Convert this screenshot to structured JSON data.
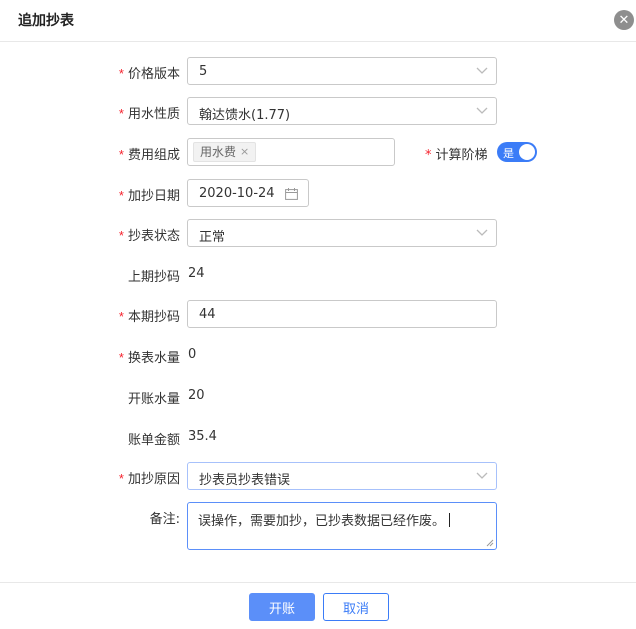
{
  "dialog": {
    "title": "追加抄表",
    "close_glyph": "✕"
  },
  "form": {
    "price_version": {
      "label": "价格版本",
      "value": "5"
    },
    "water_type": {
      "label": "用水性质",
      "value": "翰达馈水(1.77)"
    },
    "fee_composition": {
      "label": "费用组成",
      "tag": "用水费",
      "tag_close": "×"
    },
    "tiered_calc": {
      "label": "计算阶梯",
      "toggle_text": "是",
      "on": true
    },
    "read_date": {
      "label": "加抄日期",
      "value": "2020-10-24"
    },
    "meter_status": {
      "label": "抄表状态",
      "value": "正常"
    },
    "last_reading": {
      "label": "上期抄码",
      "value": "24"
    },
    "current_reading": {
      "label": "本期抄码",
      "value": "44"
    },
    "replace_volume": {
      "label": "换表水量",
      "value": "0"
    },
    "billed_volume": {
      "label": "开账水量",
      "value": "20"
    },
    "bill_amount": {
      "label": "账单金额",
      "value": "35.4"
    },
    "reason": {
      "label": "加抄原因",
      "value": "抄表员抄表错误"
    },
    "remark": {
      "label": "备注:",
      "value": "误操作，需要加抄，已抄表数据已经作废。"
    }
  },
  "required_mark": "*",
  "buttons": {
    "confirm": "开账",
    "cancel": "取消"
  },
  "colors": {
    "primary": "#5b8ff9",
    "required": "#f5222d",
    "toggle_on": "#3b7cf7"
  },
  "icons": {
    "dropdown": "chevron-down-icon",
    "calendar": "calendar-icon",
    "close": "close-icon"
  }
}
